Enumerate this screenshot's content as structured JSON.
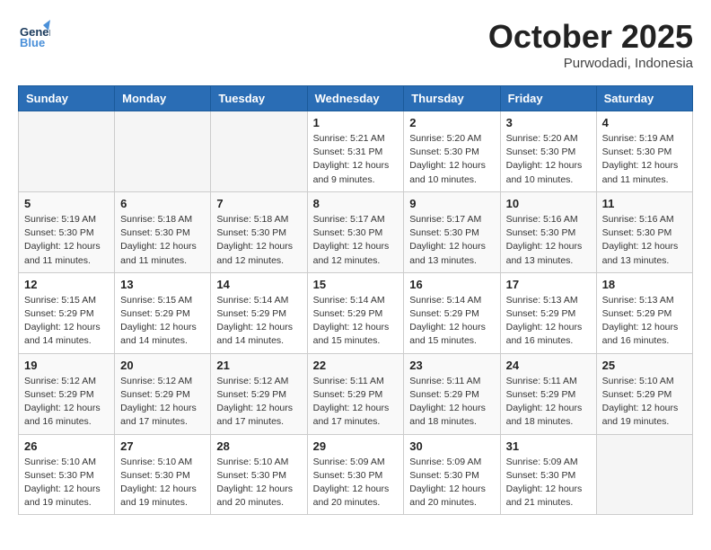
{
  "header": {
    "logo_line1": "General",
    "logo_line2": "Blue",
    "month": "October 2025",
    "location": "Purwodadi, Indonesia"
  },
  "weekdays": [
    "Sunday",
    "Monday",
    "Tuesday",
    "Wednesday",
    "Thursday",
    "Friday",
    "Saturday"
  ],
  "weeks": [
    [
      {
        "day": "",
        "info": ""
      },
      {
        "day": "",
        "info": ""
      },
      {
        "day": "",
        "info": ""
      },
      {
        "day": "1",
        "info": "Sunrise: 5:21 AM\nSunset: 5:31 PM\nDaylight: 12 hours\nand 9 minutes."
      },
      {
        "day": "2",
        "info": "Sunrise: 5:20 AM\nSunset: 5:30 PM\nDaylight: 12 hours\nand 10 minutes."
      },
      {
        "day": "3",
        "info": "Sunrise: 5:20 AM\nSunset: 5:30 PM\nDaylight: 12 hours\nand 10 minutes."
      },
      {
        "day": "4",
        "info": "Sunrise: 5:19 AM\nSunset: 5:30 PM\nDaylight: 12 hours\nand 11 minutes."
      }
    ],
    [
      {
        "day": "5",
        "info": "Sunrise: 5:19 AM\nSunset: 5:30 PM\nDaylight: 12 hours\nand 11 minutes."
      },
      {
        "day": "6",
        "info": "Sunrise: 5:18 AM\nSunset: 5:30 PM\nDaylight: 12 hours\nand 11 minutes."
      },
      {
        "day": "7",
        "info": "Sunrise: 5:18 AM\nSunset: 5:30 PM\nDaylight: 12 hours\nand 12 minutes."
      },
      {
        "day": "8",
        "info": "Sunrise: 5:17 AM\nSunset: 5:30 PM\nDaylight: 12 hours\nand 12 minutes."
      },
      {
        "day": "9",
        "info": "Sunrise: 5:17 AM\nSunset: 5:30 PM\nDaylight: 12 hours\nand 13 minutes."
      },
      {
        "day": "10",
        "info": "Sunrise: 5:16 AM\nSunset: 5:30 PM\nDaylight: 12 hours\nand 13 minutes."
      },
      {
        "day": "11",
        "info": "Sunrise: 5:16 AM\nSunset: 5:30 PM\nDaylight: 12 hours\nand 13 minutes."
      }
    ],
    [
      {
        "day": "12",
        "info": "Sunrise: 5:15 AM\nSunset: 5:29 PM\nDaylight: 12 hours\nand 14 minutes."
      },
      {
        "day": "13",
        "info": "Sunrise: 5:15 AM\nSunset: 5:29 PM\nDaylight: 12 hours\nand 14 minutes."
      },
      {
        "day": "14",
        "info": "Sunrise: 5:14 AM\nSunset: 5:29 PM\nDaylight: 12 hours\nand 14 minutes."
      },
      {
        "day": "15",
        "info": "Sunrise: 5:14 AM\nSunset: 5:29 PM\nDaylight: 12 hours\nand 15 minutes."
      },
      {
        "day": "16",
        "info": "Sunrise: 5:14 AM\nSunset: 5:29 PM\nDaylight: 12 hours\nand 15 minutes."
      },
      {
        "day": "17",
        "info": "Sunrise: 5:13 AM\nSunset: 5:29 PM\nDaylight: 12 hours\nand 16 minutes."
      },
      {
        "day": "18",
        "info": "Sunrise: 5:13 AM\nSunset: 5:29 PM\nDaylight: 12 hours\nand 16 minutes."
      }
    ],
    [
      {
        "day": "19",
        "info": "Sunrise: 5:12 AM\nSunset: 5:29 PM\nDaylight: 12 hours\nand 16 minutes."
      },
      {
        "day": "20",
        "info": "Sunrise: 5:12 AM\nSunset: 5:29 PM\nDaylight: 12 hours\nand 17 minutes."
      },
      {
        "day": "21",
        "info": "Sunrise: 5:12 AM\nSunset: 5:29 PM\nDaylight: 12 hours\nand 17 minutes."
      },
      {
        "day": "22",
        "info": "Sunrise: 5:11 AM\nSunset: 5:29 PM\nDaylight: 12 hours\nand 17 minutes."
      },
      {
        "day": "23",
        "info": "Sunrise: 5:11 AM\nSunset: 5:29 PM\nDaylight: 12 hours\nand 18 minutes."
      },
      {
        "day": "24",
        "info": "Sunrise: 5:11 AM\nSunset: 5:29 PM\nDaylight: 12 hours\nand 18 minutes."
      },
      {
        "day": "25",
        "info": "Sunrise: 5:10 AM\nSunset: 5:29 PM\nDaylight: 12 hours\nand 19 minutes."
      }
    ],
    [
      {
        "day": "26",
        "info": "Sunrise: 5:10 AM\nSunset: 5:30 PM\nDaylight: 12 hours\nand 19 minutes."
      },
      {
        "day": "27",
        "info": "Sunrise: 5:10 AM\nSunset: 5:30 PM\nDaylight: 12 hours\nand 19 minutes."
      },
      {
        "day": "28",
        "info": "Sunrise: 5:10 AM\nSunset: 5:30 PM\nDaylight: 12 hours\nand 20 minutes."
      },
      {
        "day": "29",
        "info": "Sunrise: 5:09 AM\nSunset: 5:30 PM\nDaylight: 12 hours\nand 20 minutes."
      },
      {
        "day": "30",
        "info": "Sunrise: 5:09 AM\nSunset: 5:30 PM\nDaylight: 12 hours\nand 20 minutes."
      },
      {
        "day": "31",
        "info": "Sunrise: 5:09 AM\nSunset: 5:30 PM\nDaylight: 12 hours\nand 21 minutes."
      },
      {
        "day": "",
        "info": ""
      }
    ]
  ]
}
